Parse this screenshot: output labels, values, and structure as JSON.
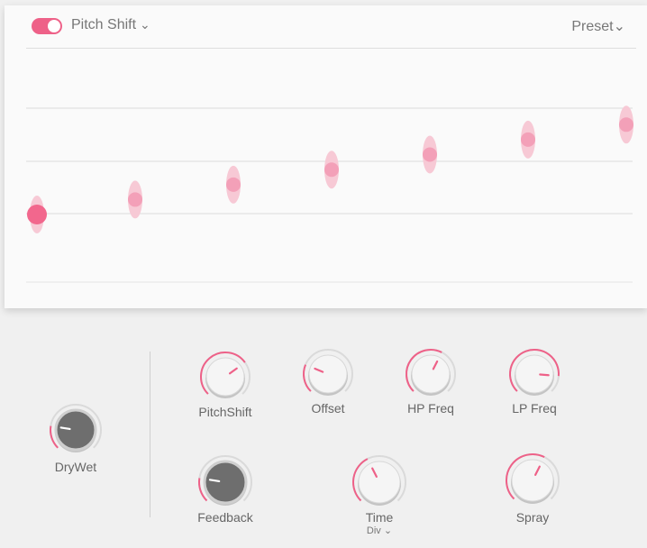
{
  "header": {
    "effect_enabled": true,
    "effect_name": "Pitch Shift",
    "effect_chevron": "⌄",
    "preset_label": "Preset",
    "preset_chevron": "⌄"
  },
  "colors": {
    "accent": "#ee6188",
    "dot_halo": "#f7c9d5",
    "knob_light": "#f5f5f5",
    "knob_dark": "#6e6e6e",
    "grid": "#dcdcdc"
  },
  "graph": {
    "points": [
      {
        "step": 1,
        "value": 0.0
      },
      {
        "step": 2,
        "value": 0.097
      },
      {
        "step": 3,
        "value": 0.194
      },
      {
        "step": 4,
        "value": 0.291
      },
      {
        "step": 5,
        "value": 0.389
      },
      {
        "step": 6,
        "value": 0.486
      },
      {
        "step": 7,
        "value": 0.583
      }
    ]
  },
  "knobs": {
    "drywet": {
      "label": "DryWet",
      "value": 0.2,
      "style": "dark"
    },
    "pitchshift": {
      "label": "PitchShift",
      "value": 0.7,
      "style": "light"
    },
    "offset": {
      "label": "Offset",
      "value": 0.25,
      "style": "light"
    },
    "hp_freq": {
      "label": "HP Freq",
      "value": 0.6,
      "style": "light"
    },
    "lp_freq": {
      "label": "LP Freq",
      "value": 0.85,
      "style": "light"
    },
    "feedback": {
      "label": "Feedback",
      "value": 0.2,
      "style": "dark"
    },
    "time": {
      "label": "Time",
      "sublabel": "Div",
      "sub_chevron": "⌄",
      "value": 0.4,
      "style": "light"
    },
    "spray": {
      "label": "Spray",
      "value": 0.6,
      "style": "light"
    }
  }
}
